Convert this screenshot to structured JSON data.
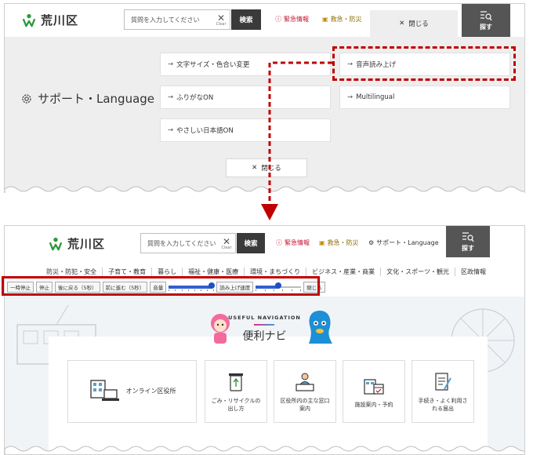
{
  "header": {
    "logo_text": "荒川区",
    "search_placeholder": "質問を入力してください",
    "clear_label": "Clear",
    "search_button": "検索",
    "emergency": "緊急情報",
    "disaster": "救急・防災",
    "support_link": "サポート・Language",
    "search_menu": "探す"
  },
  "panel1": {
    "close_tab": "閉じる",
    "support_title": "サポート・Language",
    "options": [
      "文字サイズ・色合い変更",
      "音声読み上げ",
      "ふりがなON",
      "Multilingual",
      "やさしい日本語ON"
    ],
    "close_button": "閉じる"
  },
  "panel2": {
    "nav": [
      "防災・防犯・安全",
      "子育て・教育",
      "暮らし",
      "福祉・健康・医療",
      "環境・まちづくり",
      "ビジネス・産業・商業",
      "文化・スポーツ・観光",
      "区政情報"
    ],
    "reader": {
      "pause": "一時停止",
      "stop": "停止",
      "back": "後に戻る（5秒）",
      "forward": "前に進む（5秒）",
      "volume": "音量",
      "volume_level": 0.95,
      "speed": "読み上げ速度",
      "speed_level": 0.5,
      "close": "閉じる"
    },
    "useful_title": "USEFUL NAVIGATION",
    "useful_jp": "便利ナビ",
    "cards": [
      "オンライン区役所",
      "ごみ・リサイクルの\n出し方",
      "区役所内の主な窓口\n案内",
      "施設案内・予約",
      "手続き・よく利用さ\nれる届出"
    ]
  },
  "colors": {
    "highlight": "#c00000",
    "emergency": "#c8102e",
    "logo_green": "#2e9a3a",
    "slider_blue": "#2050c8"
  }
}
